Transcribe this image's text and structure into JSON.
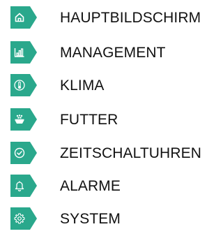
{
  "menu": {
    "accent_color": "#2aa88c",
    "items": [
      {
        "label": "HAUPTBILDSCHIRM",
        "icon": "home-icon"
      },
      {
        "label": "MANAGEMENT",
        "icon": "bar-chart-icon"
      },
      {
        "label": "KLIMA",
        "icon": "thermometer-icon"
      },
      {
        "label": "FUTTER",
        "icon": "feeder-icon"
      },
      {
        "label": "ZEITSCHALTUHREN",
        "icon": "clock-icon"
      },
      {
        "label": "ALARME",
        "icon": "bell-icon"
      },
      {
        "label": "SYSTEM",
        "icon": "gear-icon"
      }
    ]
  }
}
